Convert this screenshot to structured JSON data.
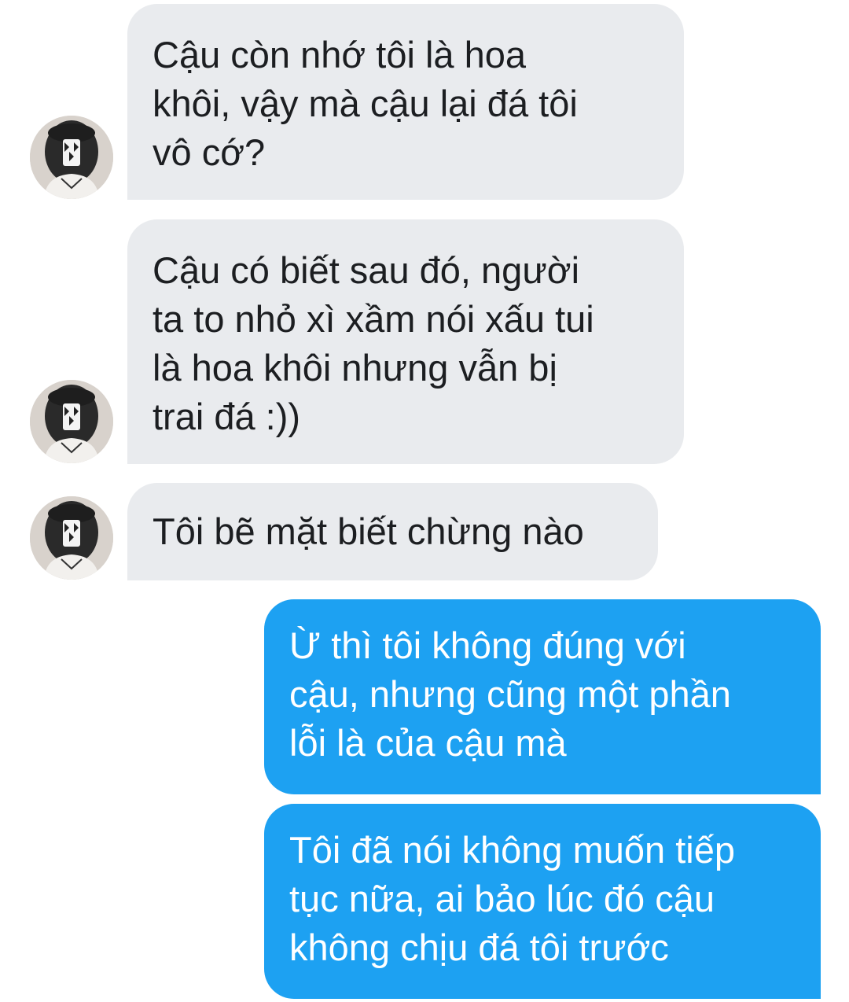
{
  "conversation": {
    "messages": [
      {
        "sender": "incoming",
        "text": "Cậu còn nhớ tôi là hoa\nkhôi, vậy mà cậu lại đá tôi\nvô cớ?",
        "avatar_icon": "user-avatar-icon"
      },
      {
        "sender": "incoming",
        "text": "Cậu có biết sau đó, người\nta to nhỏ xì xầm nói xấu tui\nlà hoa khôi nhưng vẫn bị\ntrai đá :))",
        "avatar_icon": "user-avatar-icon"
      },
      {
        "sender": "incoming",
        "text": "Tôi bẽ mặt biết chừng nào",
        "avatar_icon": "user-avatar-icon"
      },
      {
        "sender": "outgoing",
        "text": "Ừ thì tôi không đúng với\ncậu, nhưng cũng một phần\nlỗi là của cậu mà"
      },
      {
        "sender": "outgoing",
        "text": "Tôi đã nói không muốn tiếp\ntục nữa, ai bảo lúc đó cậu\nkhông chịu đá tôi trước"
      }
    ]
  },
  "colors": {
    "incoming_bubble": "#e9ebee",
    "outgoing_bubble": "#1da1f2",
    "incoming_text": "#1c1e21",
    "outgoing_text": "#ffffff"
  }
}
